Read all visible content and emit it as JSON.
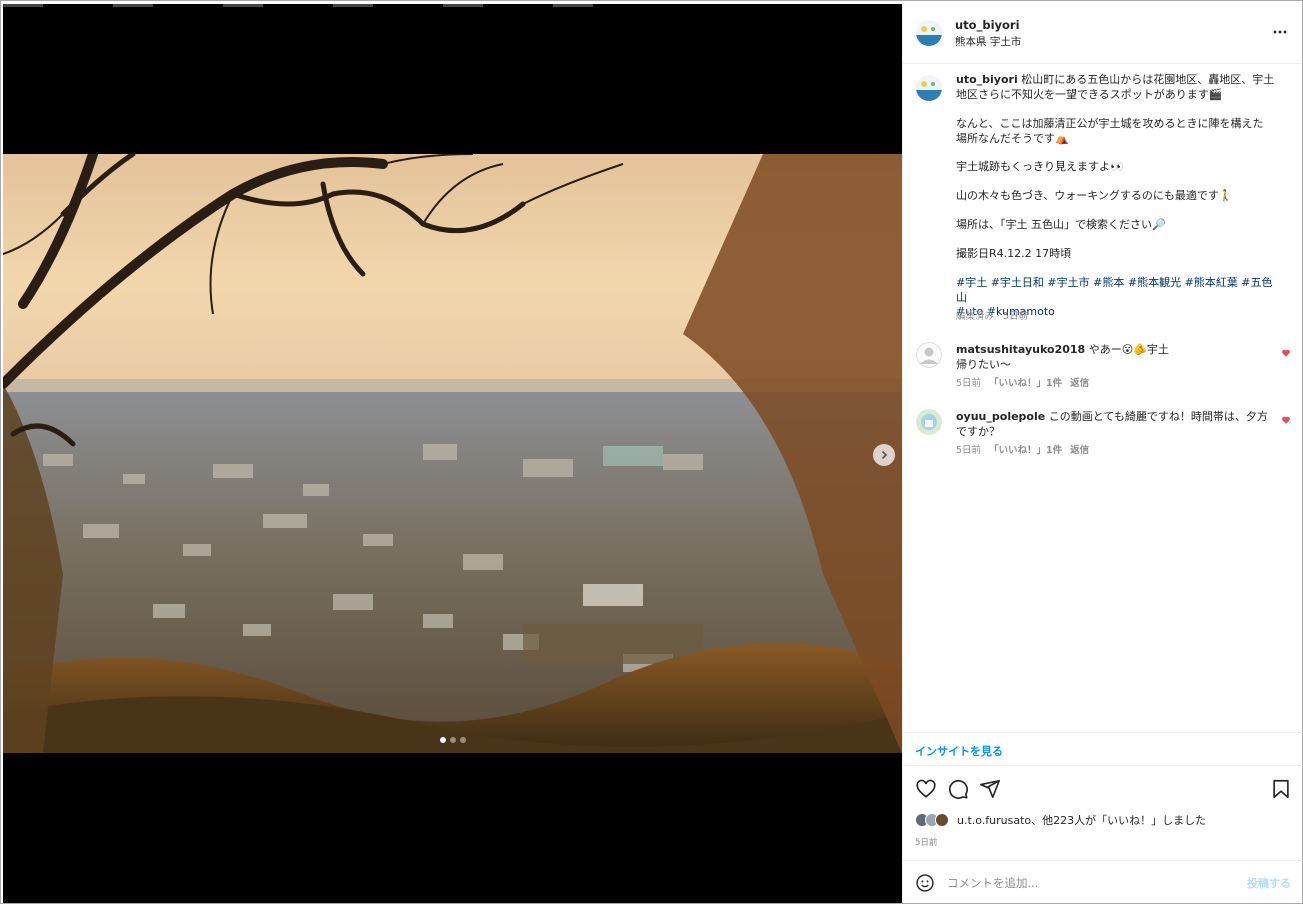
{
  "post": {
    "username": "uto_biyori",
    "location": "熊本県 宇土市",
    "caption_lines": [
      "松山町にある五色山からは花園地区、轟地区、宇土",
      "地区さらに不知火を一望できるスポットがあります🎬",
      "なんと、ここは加藤清正公が宇土城を攻めるときに陣を構えた",
      "場所なんだそうです⛺",
      "宇土城跡もくっきり見えますよ👀",
      "山の木々も色づき、ウォーキングするのにも最適です🚶",
      "場所は、「宇土 五色山」で検索ください🔎",
      "撮影日R4.12.2 17時頃"
    ],
    "hashtags_line1": "#宇土 #宇土日和 #宇土市 #熊本 #熊本観光 #熊本紅葉 #五色山",
    "hashtags_line2": "#uto #kumamoto",
    "caption_meta": "編集済み · 5日前"
  },
  "comments": [
    {
      "username": "matsushitayuko2018",
      "text_line1": "やあー😮🫵宇土",
      "text_line2": "帰りたい〜",
      "age": "5日前",
      "likes": "「いいね！」1件",
      "reply": "返信"
    },
    {
      "username": "oyuu_polepole",
      "text_line1": "この動画とても綺麗ですね！時間帯は、夕方",
      "text_line2": "ですか？",
      "age": "5日前",
      "likes": "「いいね！」1件",
      "reply": "返信"
    }
  ],
  "insight_label": "インサイトを見る",
  "likes_summary": "u.t.o.furusato、他223人が「いいね！」しました",
  "post_date": "5日前",
  "comment_placeholder": "コメントを追加...",
  "post_button": "投稿する",
  "icons": [
    "more-icon",
    "heart-icon",
    "comment-icon",
    "share-icon",
    "bookmark-icon",
    "emoji-icon",
    "chevron-right-icon"
  ],
  "colors": {
    "link": "#0095f6",
    "hashtag": "#00376b",
    "like": "#ed4956",
    "muted": "#8e8e8e",
    "post_disabled": "#b2dffc"
  }
}
